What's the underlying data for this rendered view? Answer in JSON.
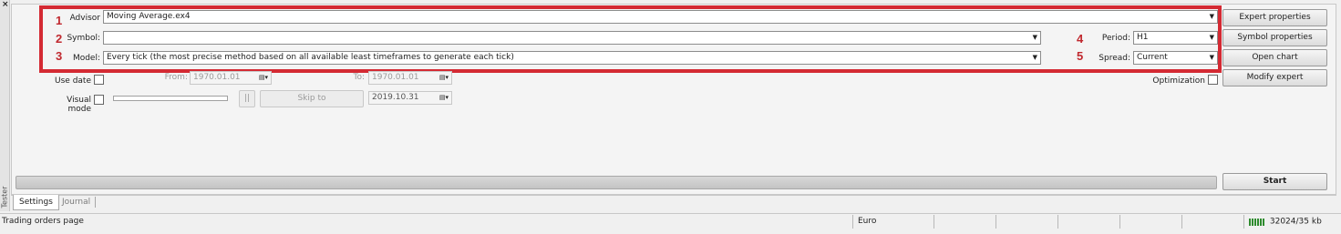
{
  "window": {
    "close_glyph": "×",
    "side_label": "Tester"
  },
  "advisor": {
    "label": "Advisor",
    "value": "Moving Average.ex4"
  },
  "symbol": {
    "label": "Symbol:",
    "value": ""
  },
  "model": {
    "label": "Model:",
    "value": "Every tick (the most precise method based on all available least timeframes to generate each tick)"
  },
  "period": {
    "label": "Period:",
    "value": "H1"
  },
  "spread": {
    "label": "Spread:",
    "value": "Current"
  },
  "use_date": {
    "label": "Use date",
    "from_label": "From:",
    "from_value": "1970.01.01",
    "to_label": "To:",
    "to_value": "1970.01.01"
  },
  "visual_mode": {
    "label": "Visual mode",
    "pause_label": "||",
    "skip_label": "Skip to",
    "skip_date": "2019.10.31"
  },
  "optimization": {
    "label": "Optimization"
  },
  "markers": [
    "1",
    "2",
    "3",
    "4",
    "5"
  ],
  "buttons": {
    "expert_properties": "Expert properties",
    "symbol_properties": "Symbol properties",
    "open_chart": "Open chart",
    "modify_expert": "Modify expert",
    "start": "Start"
  },
  "tabs": [
    {
      "label": "Settings",
      "active": true
    },
    {
      "label": "Journal",
      "active": false
    }
  ],
  "status": {
    "left": "Trading orders page",
    "profile": "Euro",
    "traffic": "32024/35 kb"
  },
  "colors": {
    "annotation_red": "#d42a33"
  }
}
